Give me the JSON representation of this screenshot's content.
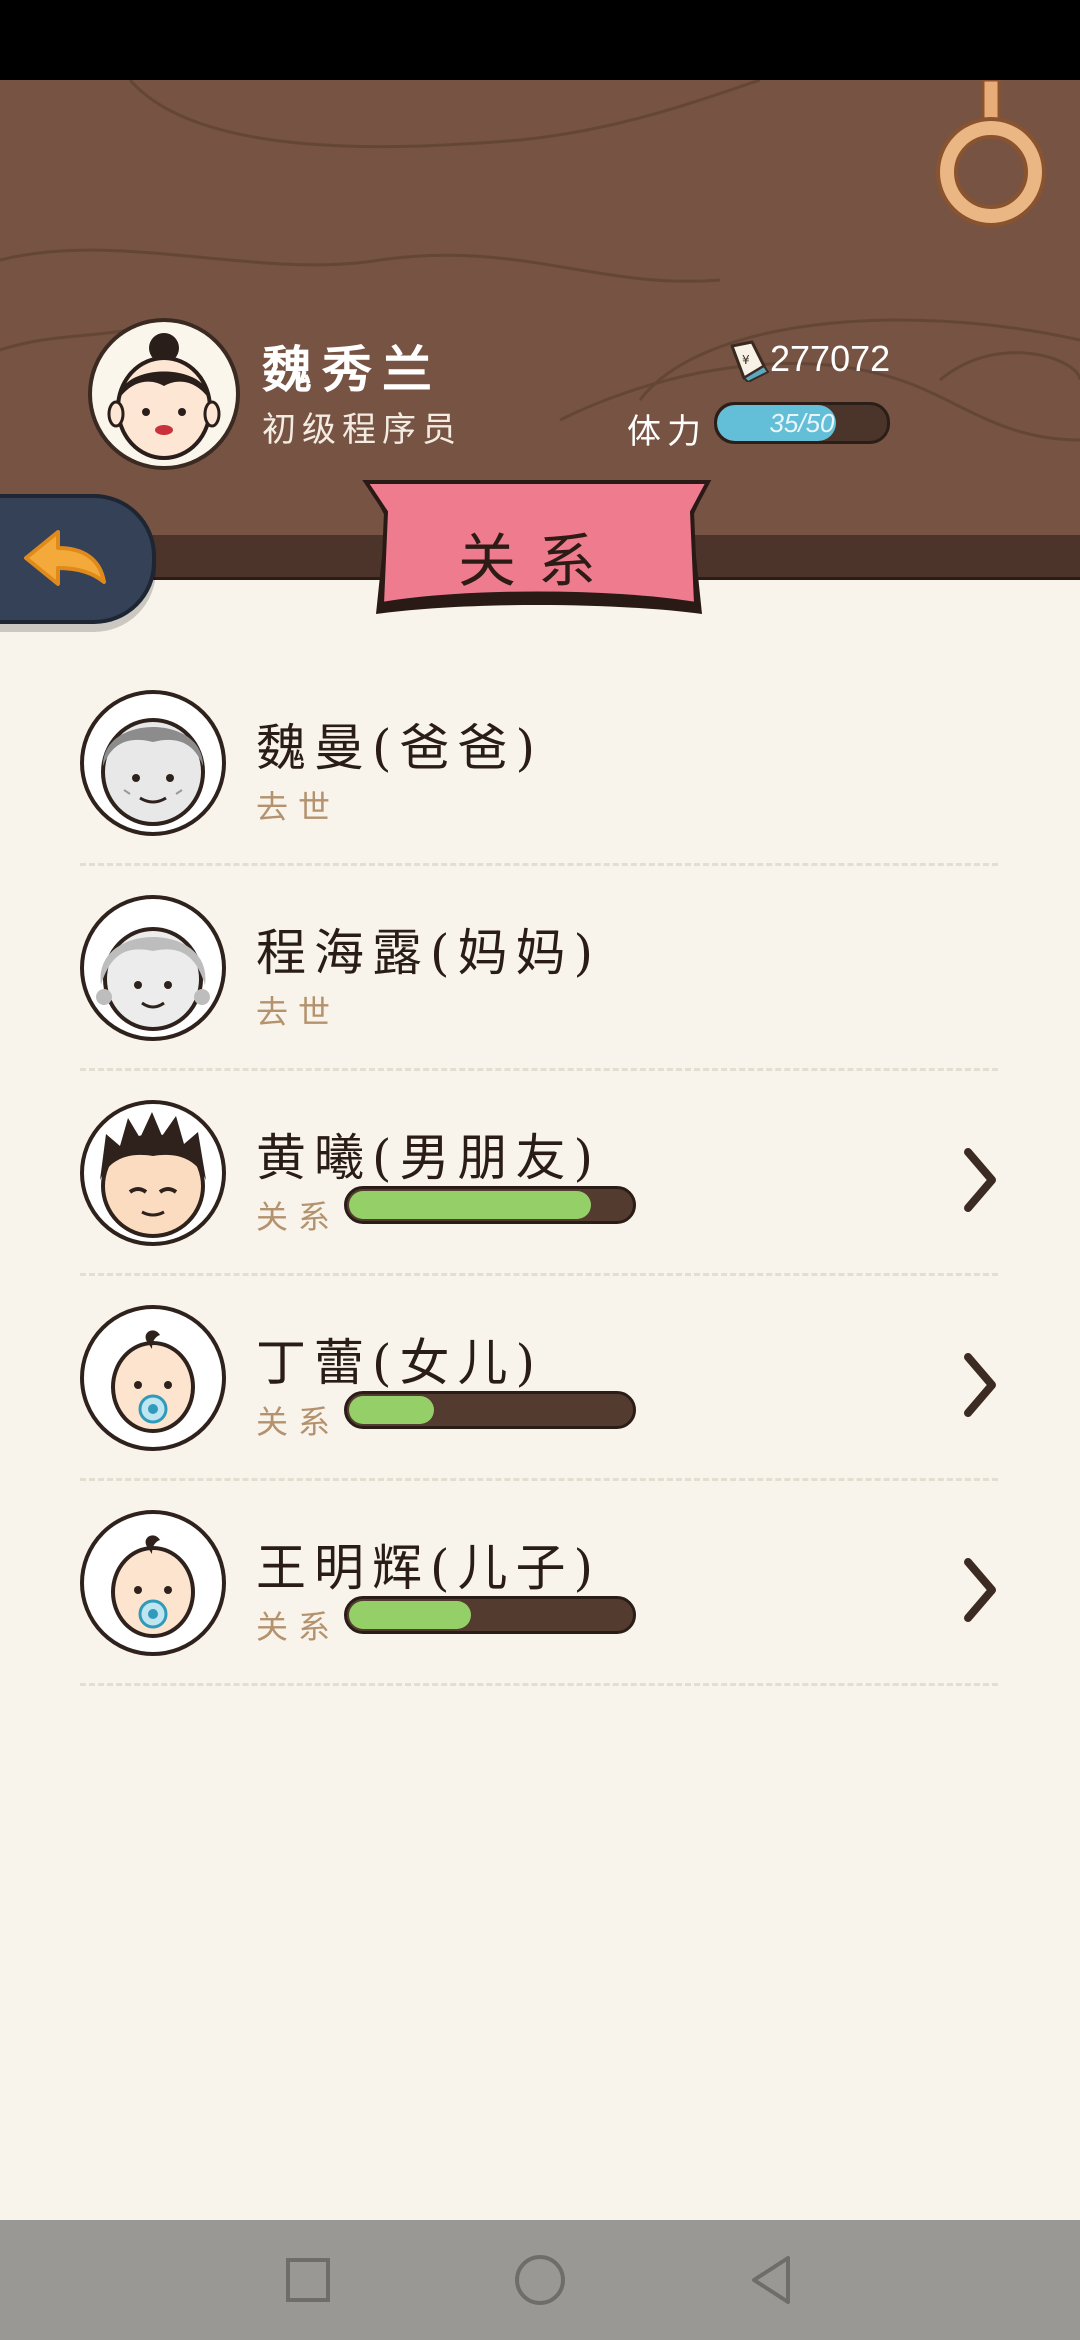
{
  "player": {
    "name": "魏秀兰",
    "title": "初级程序员",
    "money": "277072",
    "stamina_label": "体力",
    "stamina_text": "35/50",
    "stamina_value": 35,
    "stamina_max": 50
  },
  "banner": {
    "title": "关系"
  },
  "relations": [
    {
      "name": "魏曼(爸爸)",
      "status": "去世",
      "deceased": true,
      "avatar": "old-man-avatar"
    },
    {
      "name": "程海露(妈妈)",
      "status": "去世",
      "deceased": true,
      "avatar": "old-woman-avatar"
    },
    {
      "name": "黄曦(男朋友)",
      "status_label": "关系",
      "level": 0.86,
      "avatar": "young-man-avatar"
    },
    {
      "name": "丁蕾(女儿)",
      "status_label": "关系",
      "level": 0.31,
      "avatar": "baby-avatar"
    },
    {
      "name": "王明辉(儿子)",
      "status_label": "关系",
      "level": 0.44,
      "avatar": "baby-avatar"
    }
  ],
  "colors": {
    "header_wood": "#765342",
    "banner_pink": "#ef7c8e",
    "relation_green": "#94cf68",
    "stamina_blue": "#62bfd7",
    "back_button": "#344156",
    "back_arrow": "#f4aa3a"
  },
  "icons": {
    "back": "arrow-left-icon",
    "chevron": "chevron-right-icon",
    "money": "banknote-icon",
    "nav_recents": "square-icon",
    "nav_home": "circle-icon",
    "nav_back": "triangle-back-icon"
  }
}
